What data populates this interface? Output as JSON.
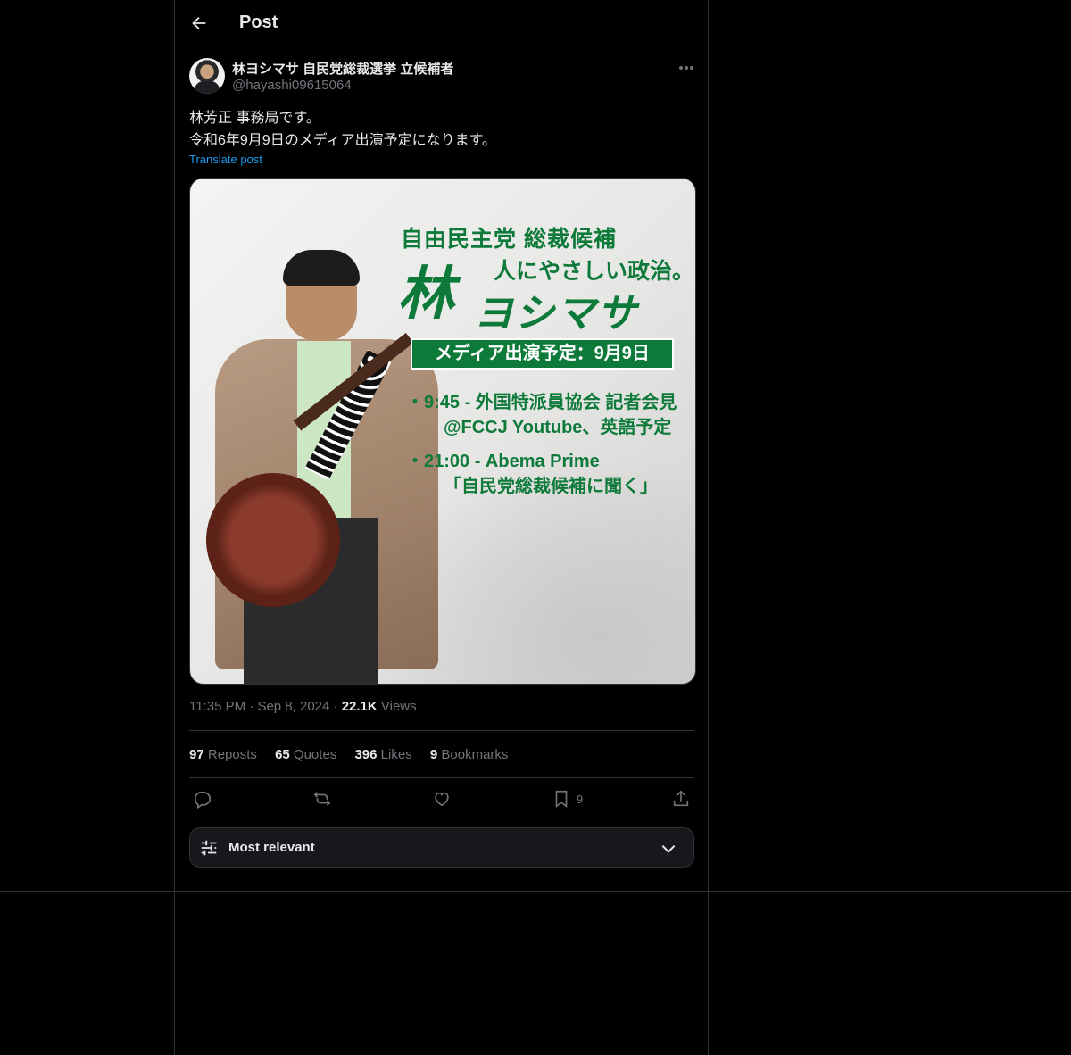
{
  "header": {
    "title": "Post"
  },
  "author": {
    "name": "林ヨシマサ 自民党総裁選挙 立候補者",
    "handle": "@hayashi09615064"
  },
  "post": {
    "line1": "林芳正 事務局です。",
    "line2": "令和6年9月9日のメディア出演予定になります。",
    "translate_label": "Translate post"
  },
  "image": {
    "party_line": "自由民主党 総裁候補",
    "tagline": "人にやさしい政治。",
    "name_kanji": "林",
    "name_kana": "ヨシマサ",
    "schedule_banner": "メディア出演予定：9月9日",
    "item1_line1": "・9:45 - 外国特派員協会 記者会見",
    "item1_line2": "@FCCJ Youtube、英語予定",
    "item2_line1": "・21:00 - Abema Prime",
    "item2_line2": "「自民党総裁候補に聞く」"
  },
  "meta": {
    "time": "11:35 PM",
    "date": "Sep 8, 2024",
    "views_count": "22.1K",
    "views_label": "Views"
  },
  "stats": {
    "reposts_count": "97",
    "reposts_label": "Reposts",
    "quotes_count": "65",
    "quotes_label": "Quotes",
    "likes_count": "396",
    "likes_label": "Likes",
    "bookmarks_count": "9",
    "bookmarks_label": "Bookmarks"
  },
  "actions": {
    "bookmark_count": "9"
  },
  "sort": {
    "label": "Most relevant"
  },
  "colors": {
    "accent": "#1d9bf0",
    "brand_green": "#0d7a3a",
    "muted": "#71767b"
  }
}
